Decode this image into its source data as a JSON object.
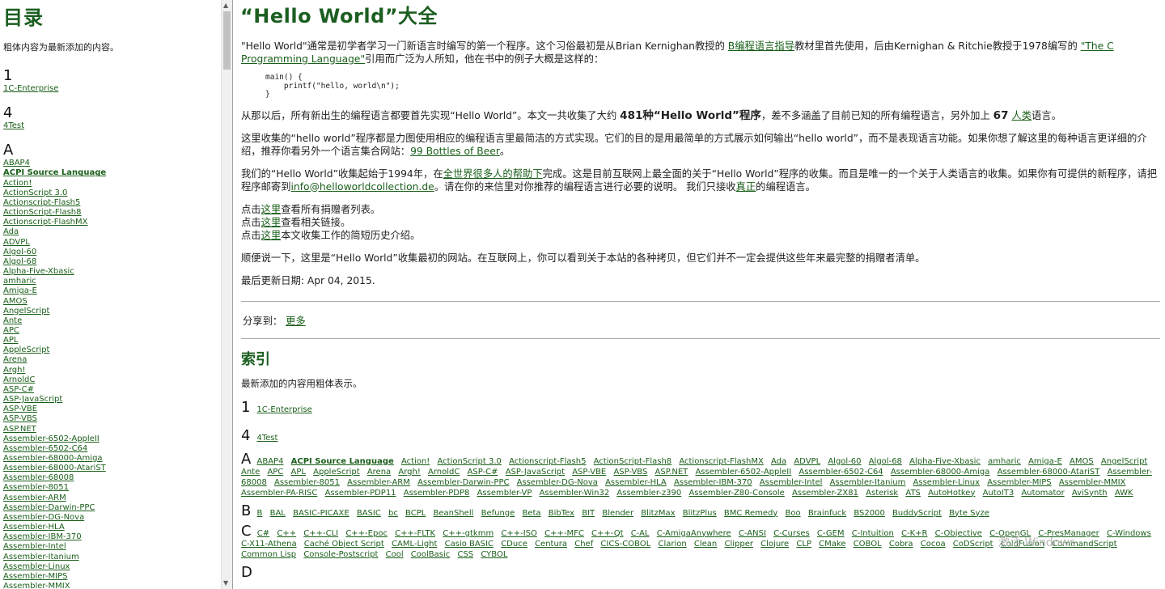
{
  "toc": {
    "title": "目录",
    "note": "粗体内容为最新添加的内容。",
    "sections": [
      {
        "letter": "1",
        "items": [
          {
            "label": "1C-Enterprise",
            "bold": false
          }
        ]
      },
      {
        "letter": "4",
        "items": [
          {
            "label": "4Test",
            "bold": false
          }
        ]
      },
      {
        "letter": "A",
        "items": [
          {
            "label": "ABAP4",
            "bold": false
          },
          {
            "label": "ACPI Source Language",
            "bold": true
          },
          {
            "label": "Action!",
            "bold": false
          },
          {
            "label": "ActionScript 3.0",
            "bold": false
          },
          {
            "label": "Actionscript-Flash5",
            "bold": false
          },
          {
            "label": "ActionScript-Flash8",
            "bold": false
          },
          {
            "label": "Actionscript-FlashMX",
            "bold": false
          },
          {
            "label": "Ada",
            "bold": false
          },
          {
            "label": "ADVPL",
            "bold": false
          },
          {
            "label": "Algol-60",
            "bold": false
          },
          {
            "label": "Algol-68",
            "bold": false
          },
          {
            "label": "Alpha-Five-Xbasic",
            "bold": false
          },
          {
            "label": "amharic",
            "bold": false
          },
          {
            "label": "Amiga-E",
            "bold": false
          },
          {
            "label": "AMOS",
            "bold": false
          },
          {
            "label": "AngelScript",
            "bold": false
          },
          {
            "label": "Ante",
            "bold": false
          },
          {
            "label": "APC",
            "bold": false
          },
          {
            "label": "APL",
            "bold": false
          },
          {
            "label": "AppleScript",
            "bold": false
          },
          {
            "label": "Arena",
            "bold": false
          },
          {
            "label": "Argh!",
            "bold": false
          },
          {
            "label": "ArnoldC",
            "bold": false
          },
          {
            "label": "ASP-C#",
            "bold": false
          },
          {
            "label": "ASP-JavaScript",
            "bold": false
          },
          {
            "label": "ASP-VBE",
            "bold": false
          },
          {
            "label": "ASP-VBS",
            "bold": false
          },
          {
            "label": "ASP.NET",
            "bold": false
          },
          {
            "label": "Assembler-6502-AppleII",
            "bold": false
          },
          {
            "label": "Assembler-6502-C64",
            "bold": false
          },
          {
            "label": "Assembler-68000-Amiga",
            "bold": false
          },
          {
            "label": "Assembler-68000-AtariST",
            "bold": false
          },
          {
            "label": "Assembler-68008",
            "bold": false
          },
          {
            "label": "Assembler-8051",
            "bold": false
          },
          {
            "label": "Assembler-ARM",
            "bold": false
          },
          {
            "label": "Assembler-Darwin-PPC",
            "bold": false
          },
          {
            "label": "Assembler-DG-Nova",
            "bold": false
          },
          {
            "label": "Assembler-HLA",
            "bold": false
          },
          {
            "label": "Assembler-IBM-370",
            "bold": false
          },
          {
            "label": "Assembler-Intel",
            "bold": false
          },
          {
            "label": "Assembler-Itanium",
            "bold": false
          },
          {
            "label": "Assembler-Linux",
            "bold": false
          },
          {
            "label": "Assembler-MIPS",
            "bold": false
          },
          {
            "label": "Assembler-MMIX",
            "bold": false
          }
        ]
      }
    ]
  },
  "main": {
    "title": "“Hello World”大全",
    "intro": {
      "t1": "\"Hello World\"通常是初学者学习一门新语言时编写的第一个程序。这个习俗最初是从Brian Kernighan教授的 ",
      "link1": "B编程语言指导",
      "t2": "教材里首先使用，后由Kernighan & Ritchie教授于1978编写的 ",
      "link2": "\"The C Programming Language\"",
      "t3": "引用而广泛为人所知，他在书中的例子大概是这样的："
    },
    "code": "main() {\n    printf(\"hello, world\\n\");\n}",
    "since": {
      "t1": "从那以后，所有新出生的编程语言都要首先实现“Hello World”。本文一共收集了大约 ",
      "b1": "481种“Hello World”程序",
      "t2": "，差不多涵盖了目前已知的所有编程语言，另外加上 ",
      "b2": "67",
      "link": "人类",
      "t3": "语言。"
    },
    "aim": {
      "t1": "这里收集的“hello world”程序都是力图使用相应的编程语言里最简洁的方式实现。它们的目的是用最简单的方式展示如何输出“hello world”，而不是表现语言功能。如果你想了解这里的每种语言更详细的介绍，推荐你看另外一个语言集合网站：",
      "link": "99 Bottles of Beer",
      "t2": "。"
    },
    "began": {
      "t1": "我们的“Hello World”收集起始于1994年，在",
      "link1": "全世界很多人的帮助下",
      "t2": "完成。这是目前互联网上最全面的关于“Hello World”程序的收集。而且是唯一的一个关于人类语言的收集。如果你有可提供的新程序，请把程序邮寄到",
      "link2": "info@helloworldcollection.de",
      "t3": "。请在你的来信里对你推荐的编程语言进行必要的说明。 我们只接收",
      "link3": "真正",
      "t4": "的编程语言。"
    },
    "clicks": [
      {
        "pre": "点击",
        "link": "这里",
        "post": "查看所有捐赠者列表。"
      },
      {
        "pre": "点击",
        "link": "这里",
        "post": "查看相关链接。"
      },
      {
        "pre": "点击",
        "link": "这里",
        "post": "本文收集工作的简短历史介绍。"
      }
    ],
    "note": "顺便说一下，这里是“Hello World”收集最初的网站。在互联网上，你可以看到关于本站的各种拷贝，但它们并不一定会提供这些年来最完整的捐赠者清单。",
    "updated": "最后更新日期: Apr 04, 2015.",
    "share": {
      "label": "分享到：",
      "more": "更多"
    },
    "index": {
      "title": "索引",
      "note": "最新添加的内容用粗体表示。",
      "row1": {
        "letter": "1",
        "link": "1C-Enterprise"
      },
      "row4": {
        "letter": "4",
        "link": "4Test"
      },
      "blocks": [
        {
          "letter": "A",
          "items": [
            {
              "label": "ABAP4"
            },
            {
              "label": "ACPI Source Language",
              "bold": true
            },
            {
              "label": "Action!"
            },
            {
              "label": "ActionScript 3.0"
            },
            {
              "label": "Actionscript-Flash5"
            },
            {
              "label": "ActionScript-Flash8"
            },
            {
              "label": "Actionscript-FlashMX"
            },
            {
              "label": "Ada"
            },
            {
              "label": "ADVPL"
            },
            {
              "label": "Algol-60"
            },
            {
              "label": "Algol-68"
            },
            {
              "label": "Alpha-Five-Xbasic"
            },
            {
              "label": "amharic"
            },
            {
              "label": "Amiga-E"
            },
            {
              "label": "AMOS"
            },
            {
              "label": "AngelScript"
            },
            {
              "label": "Ante"
            },
            {
              "label": "APC"
            },
            {
              "label": "APL"
            },
            {
              "label": "AppleScript"
            },
            {
              "label": "Arena"
            },
            {
              "label": "Argh!"
            },
            {
              "label": "ArnoldC"
            },
            {
              "label": "ASP-C#"
            },
            {
              "label": "ASP-JavaScript"
            },
            {
              "label": "ASP-VBE"
            },
            {
              "label": "ASP-VBS"
            },
            {
              "label": "ASP.NET"
            },
            {
              "label": "Assembler-6502-AppleII"
            },
            {
              "label": "Assembler-6502-C64"
            },
            {
              "label": "Assembler-68000-Amiga"
            },
            {
              "label": "Assembler-68000-AtariST"
            },
            {
              "label": "Assembler-68008"
            },
            {
              "label": "Assembler-8051"
            },
            {
              "label": "Assembler-ARM"
            },
            {
              "label": "Assembler-Darwin-PPC"
            },
            {
              "label": "Assembler-DG-Nova"
            },
            {
              "label": "Assembler-HLA"
            },
            {
              "label": "Assembler-IBM-370"
            },
            {
              "label": "Assembler-Intel"
            },
            {
              "label": "Assembler-Itanium"
            },
            {
              "label": "Assembler-Linux"
            },
            {
              "label": "Assembler-MIPS"
            },
            {
              "label": "Assembler-MMIX"
            },
            {
              "label": "Assembler-PA-RISC"
            },
            {
              "label": "Assembler-PDP11"
            },
            {
              "label": "Assembler-PDP8"
            },
            {
              "label": "Assembler-VP"
            },
            {
              "label": "Assembler-Win32"
            },
            {
              "label": "Assembler-z390"
            },
            {
              "label": "Assembler-Z80-Console"
            },
            {
              "label": "Assembler-ZX81"
            },
            {
              "label": "Asterisk"
            },
            {
              "label": "ATS"
            },
            {
              "label": "AutoHotkey"
            },
            {
              "label": "AutoIT3"
            },
            {
              "label": "Automator"
            },
            {
              "label": "AviSynth"
            },
            {
              "label": "AWK"
            }
          ]
        },
        {
          "letter": "B",
          "items": [
            {
              "label": "B"
            },
            {
              "label": "BAL"
            },
            {
              "label": "BASIC-PICAXE"
            },
            {
              "label": "BASIC"
            },
            {
              "label": "bc"
            },
            {
              "label": "BCPL"
            },
            {
              "label": "BeanShell"
            },
            {
              "label": "Befunge"
            },
            {
              "label": "Beta"
            },
            {
              "label": "BibTex"
            },
            {
              "label": "BIT"
            },
            {
              "label": "Blender"
            },
            {
              "label": "BlitzMax"
            },
            {
              "label": "BlitzPlus"
            },
            {
              "label": "BMC Remedy"
            },
            {
              "label": "Boo"
            },
            {
              "label": "Brainfuck"
            },
            {
              "label": "BS2000"
            },
            {
              "label": "BuddyScript"
            },
            {
              "label": "Byte Syze"
            }
          ]
        },
        {
          "letter": "C",
          "items": [
            {
              "label": "C#"
            },
            {
              "label": "C++"
            },
            {
              "label": "C++-CLI"
            },
            {
              "label": "C++-Epoc"
            },
            {
              "label": "C++-FLTK"
            },
            {
              "label": "C++-gtkmm"
            },
            {
              "label": "C++-ISO"
            },
            {
              "label": "C++-MFC"
            },
            {
              "label": "C++-Qt"
            },
            {
              "label": "C-AL"
            },
            {
              "label": "C-AmigaAnywhere"
            },
            {
              "label": "C-ANSI"
            },
            {
              "label": "C-Curses"
            },
            {
              "label": "C-GEM"
            },
            {
              "label": "C-Intuition"
            },
            {
              "label": "C-K+R"
            },
            {
              "label": "C-Objective"
            },
            {
              "label": "C-OpenGL"
            },
            {
              "label": "C-PresManager"
            },
            {
              "label": "C-Windows"
            },
            {
              "label": "C-X11-Athena"
            },
            {
              "label": "Caché Object Script"
            },
            {
              "label": "CAML-Light"
            },
            {
              "label": "Casio BASIC"
            },
            {
              "label": "CDuce"
            },
            {
              "label": "Centura"
            },
            {
              "label": "Chef"
            },
            {
              "label": "CICS-COBOL"
            },
            {
              "label": "Clarion"
            },
            {
              "label": "Clean"
            },
            {
              "label": "Clipper"
            },
            {
              "label": "Clojure"
            },
            {
              "label": "CLP"
            },
            {
              "label": "CMake"
            },
            {
              "label": "COBOL"
            },
            {
              "label": "Cobra"
            },
            {
              "label": "Cocoa"
            },
            {
              "label": "CoDScript"
            },
            {
              "label": "ColdFusion"
            },
            {
              "label": "CommandScript"
            },
            {
              "label": "Common Lisp"
            },
            {
              "label": "Console-Postscript"
            },
            {
              "label": "Cool"
            },
            {
              "label": "CoolBasic"
            },
            {
              "label": "CSS"
            },
            {
              "label": "CYBOL"
            }
          ]
        },
        {
          "letter": "D",
          "items": []
        }
      ]
    }
  },
  "watermark": "激活 Windows"
}
